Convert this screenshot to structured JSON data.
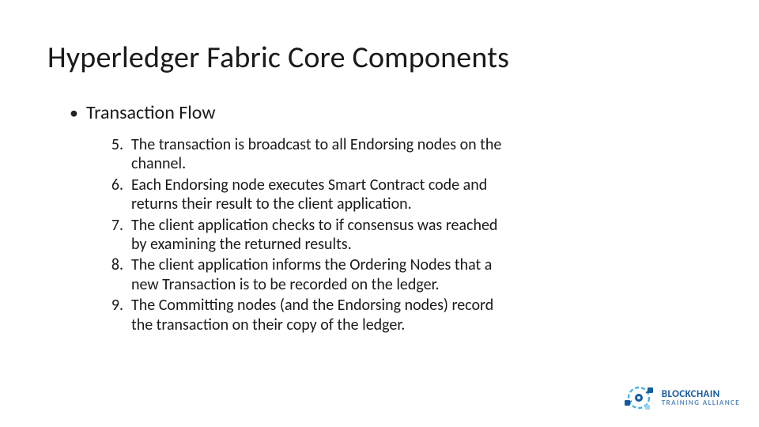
{
  "title": "Hyperledger Fabric Core Components",
  "bullet": {
    "text": "Transaction Flow"
  },
  "list": {
    "items": [
      {
        "n": "5.",
        "text": "The transaction is broadcast to all Endorsing nodes on the channel."
      },
      {
        "n": "6.",
        "text": "Each Endorsing node executes Smart Contract code and returns their result to the client application."
      },
      {
        "n": "7.",
        "text": "The client application checks to if consensus was reached by examining the returned results."
      },
      {
        "n": "8.",
        "text": "The client application informs the Ordering Nodes that a new Transaction is to be recorded on the ledger."
      },
      {
        "n": "9.",
        "text": "The Committing nodes (and the Endorsing nodes) record the transaction on their copy of the ledger."
      }
    ]
  },
  "logo": {
    "line1": "BLOCKCHAIN",
    "line2": "TRAINING ALLIANCE"
  },
  "colors": {
    "logoPrimary": "#165a9c",
    "logoAccent": "#46b2e6",
    "logoLight": "#9ed4f2"
  }
}
